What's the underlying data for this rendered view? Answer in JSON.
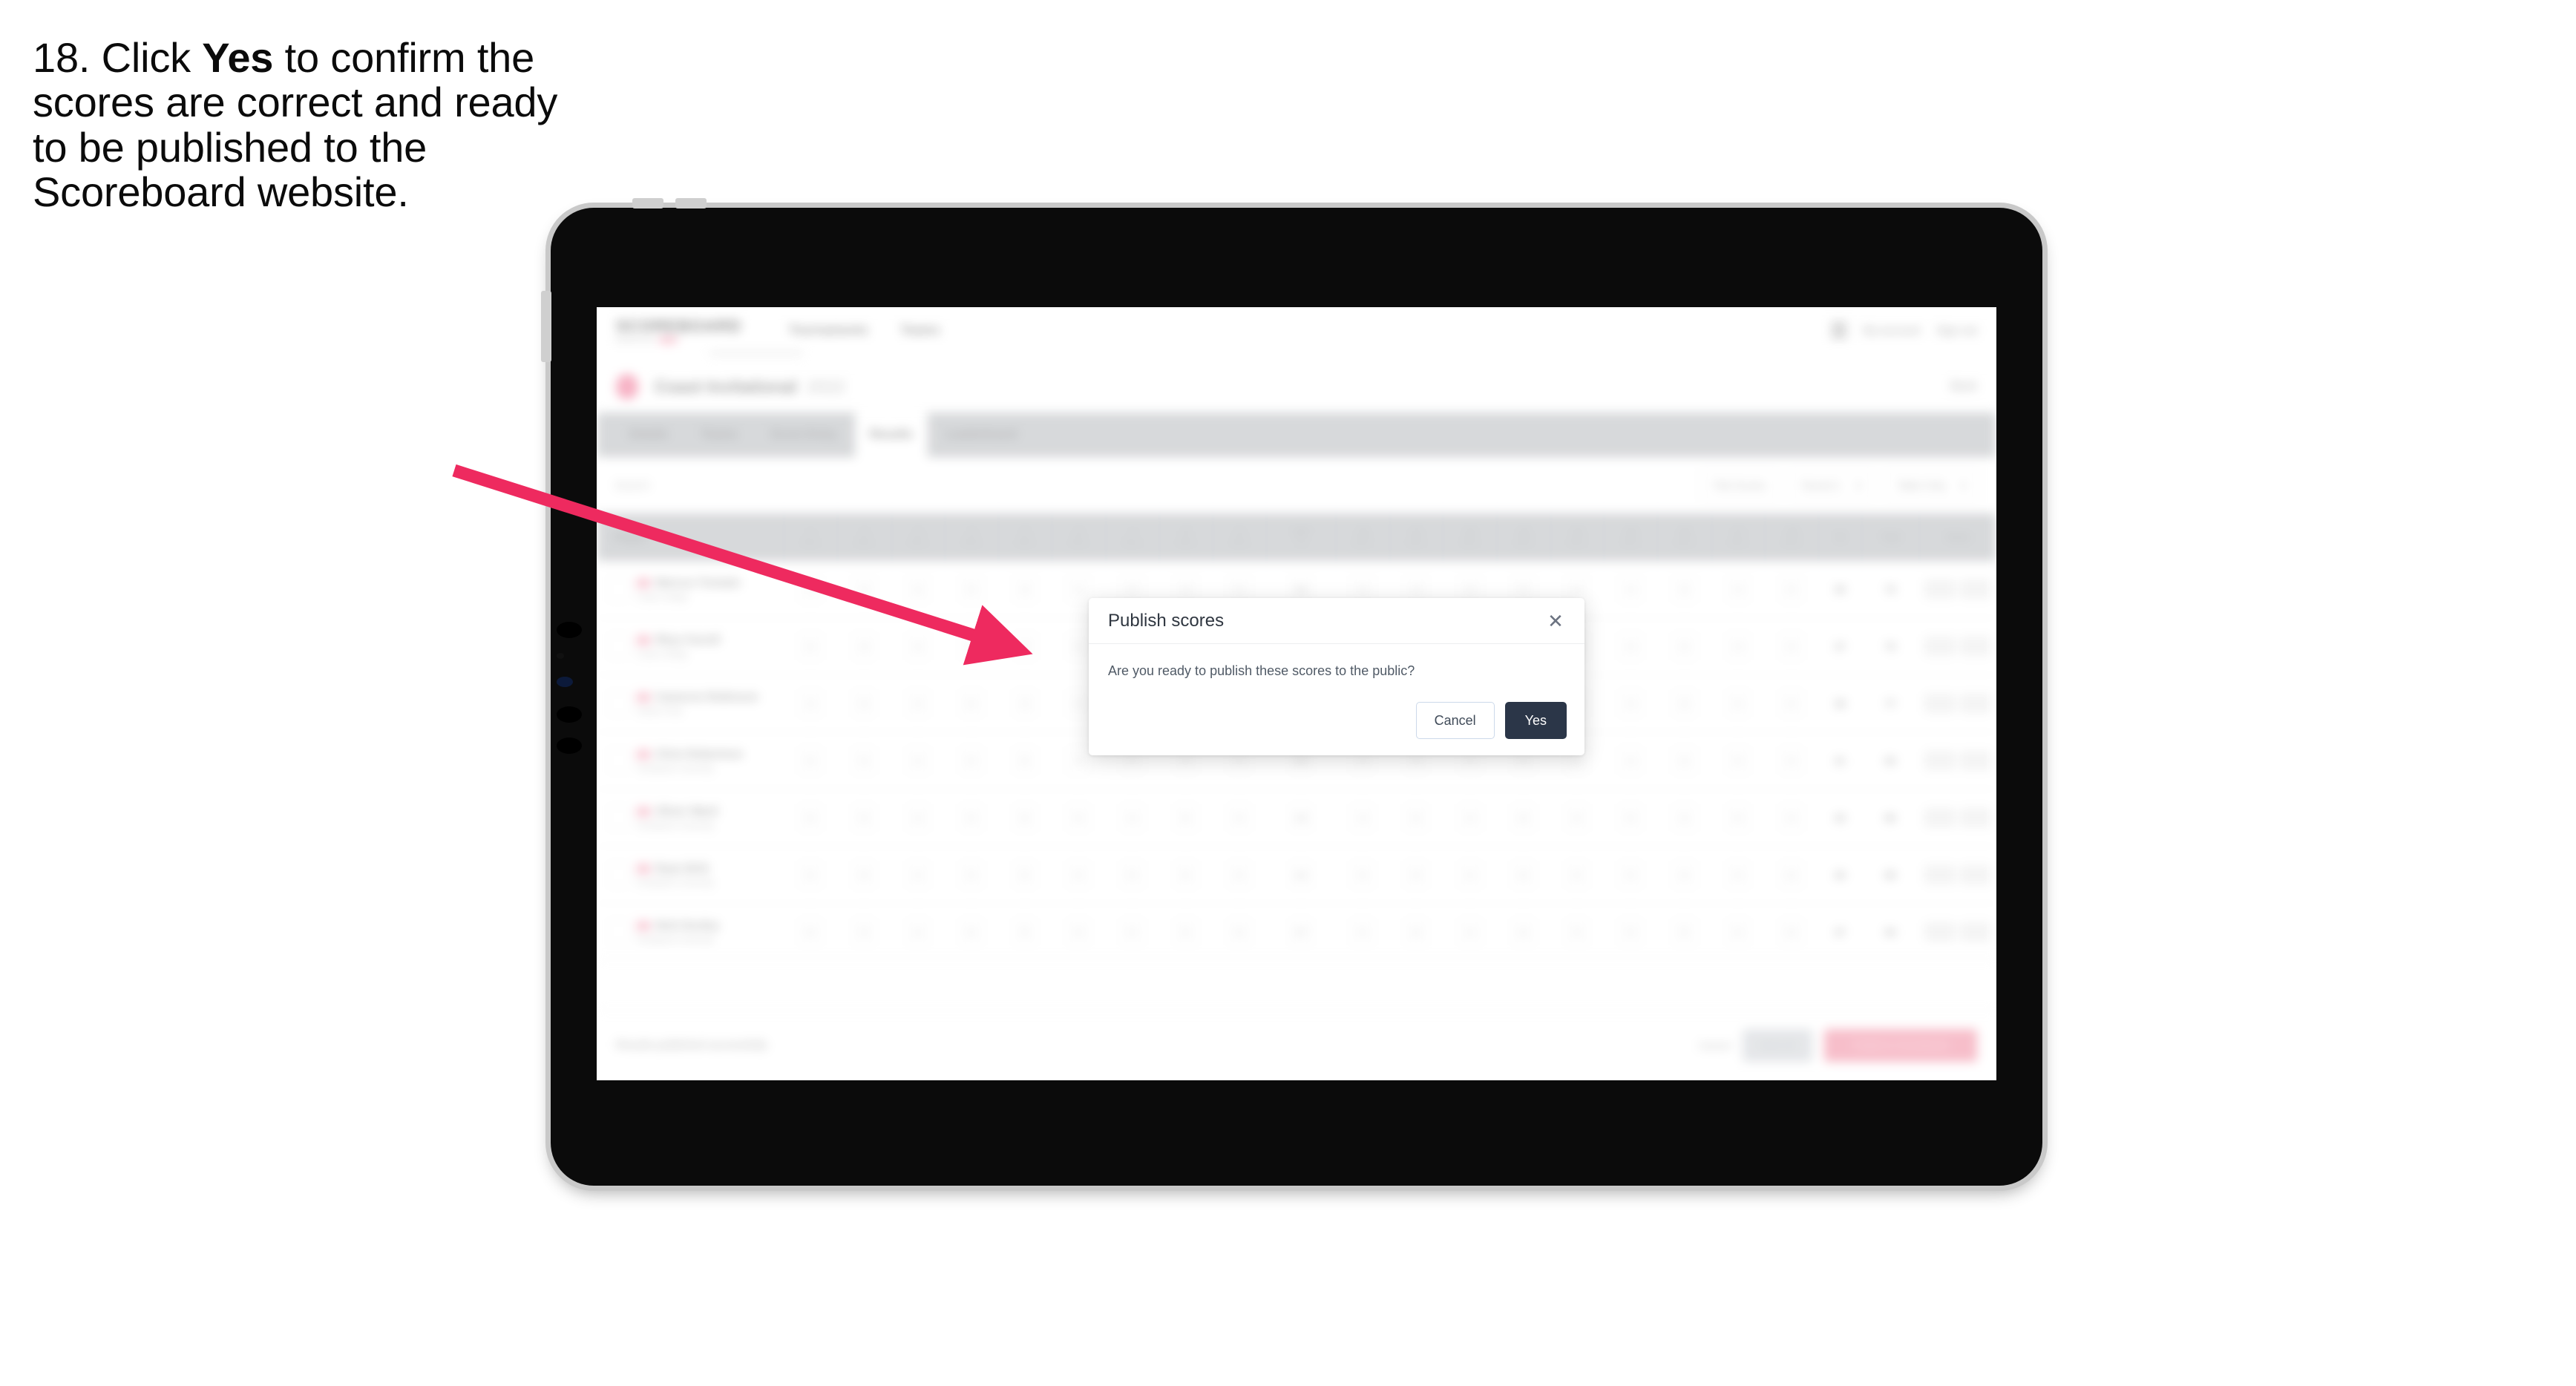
{
  "instruction": {
    "prefix": "18. Click ",
    "bold": "Yes",
    "suffix": " to confirm the scores are correct and ready to be published to the Scoreboard website."
  },
  "colors": {
    "arrow": "#ee2a5f",
    "yes_button_bg": "#2b3648",
    "cancel_border": "#ccd9ea",
    "brand_pink": "#f06a8e",
    "tab_strip": "#d4d6d8"
  },
  "modal": {
    "title": "Publish scores",
    "close_icon": "close-icon",
    "body_text": "Are you ready to publish these scores to the public?",
    "cancel_label": "Cancel",
    "confirm_label": "Yes"
  },
  "app": {
    "logo": {
      "name": "SCOREBOARD",
      "tagline": "powered by",
      "badge": "golf"
    },
    "nav": [
      {
        "label": "Tournaments"
      },
      {
        "label": "Teams"
      }
    ],
    "header_right": {
      "avatar_icon": "user-avatar-icon",
      "user_label": "My account",
      "signout_label": "Sign out"
    },
    "title_row": {
      "logo_icon": "tournament-crest-icon",
      "title": "Coast Invitational",
      "year": "2022",
      "right_label": "Back"
    },
    "tabs": [
      {
        "label": "Details",
        "active": false
      },
      {
        "label": "Teams",
        "active": false
      },
      {
        "label": "Score Entry",
        "active": false
      },
      {
        "label": "Results",
        "active": true
      },
      {
        "label": "Leaderboard",
        "active": false
      }
    ],
    "filters": {
      "search_placeholder": "Search",
      "pills": [
        "Flat Scores",
        "Round 1",
        "Table Only"
      ]
    },
    "table": {
      "player_column_header": "Player",
      "hole_columns": [
        {
          "n": "1",
          "p": "Par 4"
        },
        {
          "n": "2",
          "p": "Par 4"
        },
        {
          "n": "3",
          "p": "Par 3"
        },
        {
          "n": "4",
          "p": "Par 5"
        },
        {
          "n": "5",
          "p": "Par 4"
        },
        {
          "n": "6",
          "p": "Par 4"
        },
        {
          "n": "7",
          "p": "Par 3"
        },
        {
          "n": "8",
          "p": "Par 4"
        },
        {
          "n": "9",
          "p": "Par 5"
        },
        {
          "n": "OUT",
          "p": "36"
        },
        {
          "n": "10",
          "p": "Par 4"
        },
        {
          "n": "11",
          "p": "Par 4"
        },
        {
          "n": "12",
          "p": "Par 3"
        },
        {
          "n": "13",
          "p": "Par 5"
        },
        {
          "n": "14",
          "p": "Par 4"
        },
        {
          "n": "15",
          "p": "Par 4"
        },
        {
          "n": "16",
          "p": "Par 3"
        },
        {
          "n": "17",
          "p": "Par 4"
        },
        {
          "n": "18",
          "p": "Par 5"
        }
      ],
      "tail_columns": [
        "IN",
        "Total",
        "Status"
      ],
      "rows": [
        {
          "rank": "1",
          "name": "Marcus Tremain",
          "club": "Coast College",
          "scores": [
            "4",
            "4",
            "3",
            "5",
            "4",
            "4",
            "3",
            "4",
            "5",
            "36",
            "4",
            "4",
            "3",
            "5",
            "4",
            "4",
            "3",
            "4",
            "5"
          ],
          "in": "36",
          "total": "72",
          "status": "Final"
        },
        {
          "rank": "2",
          "name": "Rhys Farrell",
          "club": "Coast College",
          "scores": [
            "5",
            "4",
            "3",
            "5",
            "4",
            "5",
            "3",
            "4",
            "5",
            "38",
            "4",
            "4",
            "3",
            "5",
            "4",
            "4",
            "4",
            "4",
            "5"
          ],
          "in": "37",
          "total": "75",
          "status": "Final"
        },
        {
          "rank": "3",
          "name": "Cameron Robinson",
          "club": "Harbor Point",
          "scores": [
            "4",
            "5",
            "4",
            "5",
            "4",
            "4",
            "3",
            "5",
            "5",
            "39",
            "4",
            "5",
            "3",
            "5",
            "4",
            "4",
            "3",
            "5",
            "5"
          ],
          "in": "38",
          "total": "77",
          "status": "Final"
        },
        {
          "rank": "4",
          "name": "Chris Robertson",
          "club": "Southpoint University",
          "scores": [
            "5",
            "5",
            "4",
            "5",
            "5",
            "4",
            "4",
            "5",
            "5",
            "42",
            "4",
            "5",
            "4",
            "5",
            "5",
            "4",
            "4",
            "5",
            "5"
          ],
          "in": "41",
          "total": "83",
          "status": "Final"
        },
        {
          "rank": "5",
          "name": "Oliver Ward",
          "club": "Southpoint University",
          "scores": [
            "5",
            "5",
            "4",
            "5",
            "5",
            "5",
            "4",
            "5",
            "5",
            "43",
            "4",
            "5",
            "4",
            "6",
            "5",
            "5",
            "4",
            "5",
            "5"
          ],
          "in": "43",
          "total": "86",
          "status": "Final"
        },
        {
          "rank": "6",
          "name": "Ryan Britt",
          "club": "Southpoint University",
          "scores": [
            "5",
            "5",
            "4",
            "5",
            "5",
            "5",
            "5",
            "5",
            "5",
            "44",
            "5",
            "5",
            "4",
            "6",
            "5",
            "5",
            "4",
            "5",
            "6"
          ],
          "in": "45",
          "total": "89",
          "status": "Final"
        },
        {
          "rank": "7",
          "name": "Nick Dooley",
          "club": "Southpoint University",
          "scores": [
            "6",
            "5",
            "4",
            "6",
            "5",
            "5",
            "5",
            "5",
            "6",
            "47",
            "5",
            "6",
            "4",
            "6",
            "5",
            "5",
            "5",
            "5",
            "6"
          ],
          "in": "47",
          "total": "94",
          "status": "Final"
        }
      ]
    },
    "footer": {
      "message": "Results published successfully",
      "link_label": "Cancel",
      "secondary_button": "Save all",
      "primary_button": "Publish to Scoreboard"
    }
  }
}
